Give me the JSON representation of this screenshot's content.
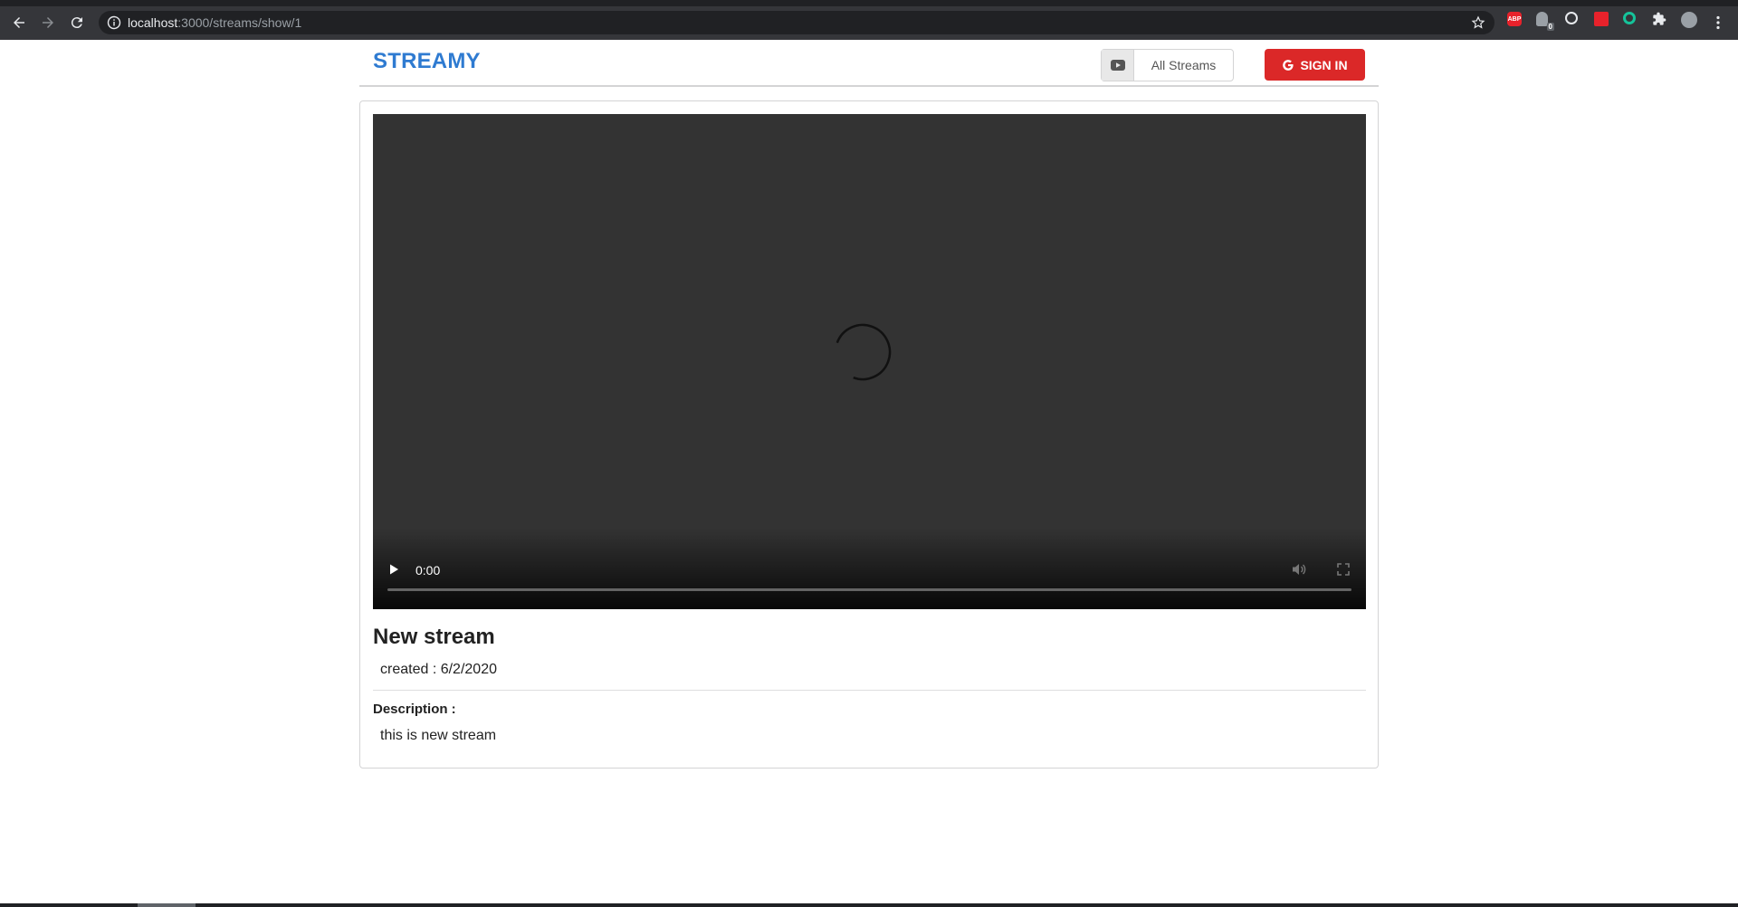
{
  "browser": {
    "url_host": "localhost",
    "url_path": ":3000/streams/show/1",
    "extensions": [
      {
        "name": "adblock-plus-icon",
        "label": "ABP",
        "color": "#e8222b"
      },
      {
        "name": "ghostery-icon",
        "label": "0",
        "color": "#9aa0a6"
      },
      {
        "name": "globe-extension-icon",
        "label": "",
        "color": "#e8eaed"
      },
      {
        "name": "gift-extension-icon",
        "label": "",
        "color": "#e8222b"
      },
      {
        "name": "grammarly-icon",
        "label": "",
        "color": "#15c39a"
      },
      {
        "name": "puzzle-icon",
        "label": "",
        "color": "#e8eaed"
      },
      {
        "name": "profile-avatar-icon",
        "label": "",
        "color": "#9aa0a6"
      }
    ]
  },
  "header": {
    "brand": "STREAMY",
    "all_streams_label": "All Streams",
    "sign_in_label": "SIGN IN"
  },
  "colors": {
    "brand": "#2f7bd1",
    "sign_in": "#db2828",
    "video_bg": "#333333"
  },
  "video": {
    "time": "0:00",
    "progress": 0
  },
  "stream": {
    "title": "New stream",
    "created": "created : 6/2/2020",
    "description_label": "Description :",
    "description": "this is new stream"
  }
}
